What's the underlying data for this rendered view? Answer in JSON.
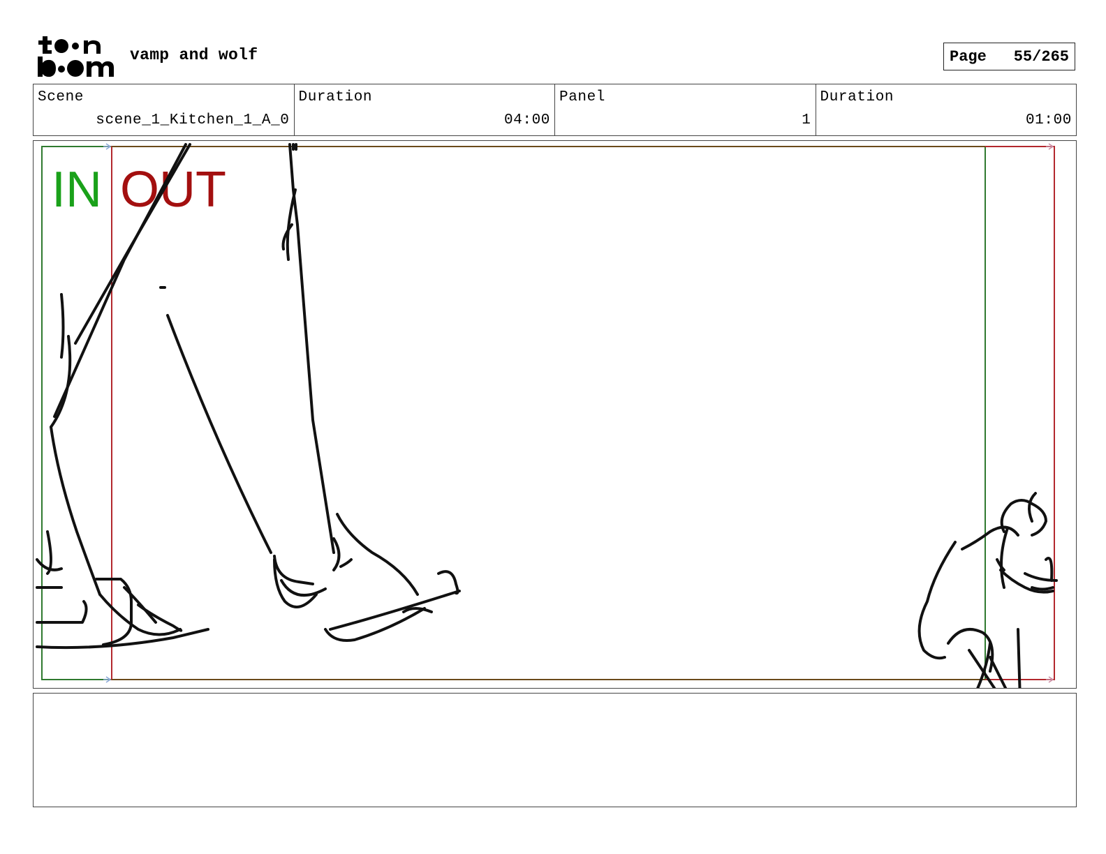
{
  "header": {
    "logo": "toon boom",
    "project_title": "vamp and wolf",
    "page_label": "Page",
    "page_number": "55/265"
  },
  "info": {
    "scene_label": "Scene",
    "scene_value": "scene_1_Kitchen_1_A_0",
    "scene_duration_label": "Duration",
    "scene_duration_value": "04:00",
    "panel_label": "Panel",
    "panel_value": "1",
    "panel_duration_label": "Duration",
    "panel_duration_value": "01:00"
  },
  "panel": {
    "in_label": "IN",
    "out_label": "OUT",
    "in_color": "#1aa11a",
    "out_color": "#a30f0f"
  },
  "notes": {}
}
